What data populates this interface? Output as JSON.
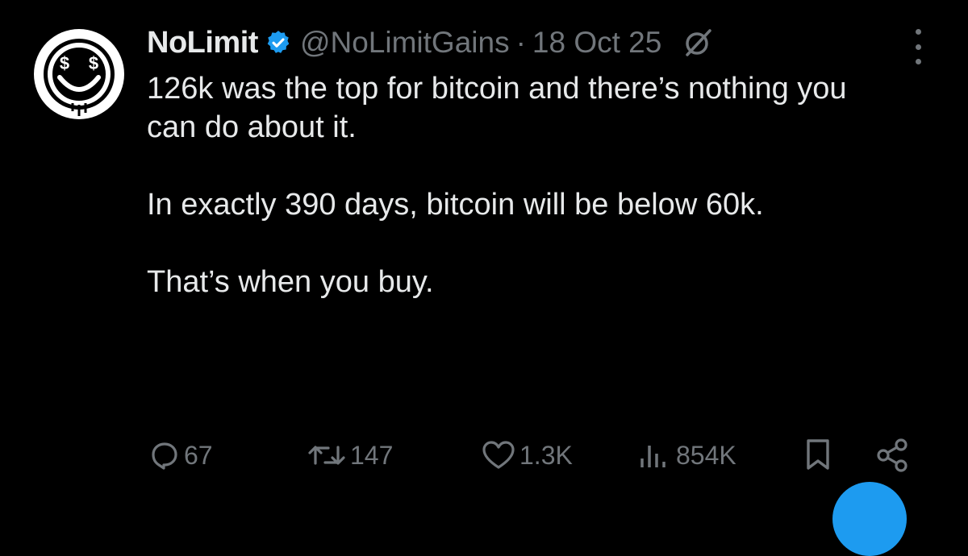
{
  "tweet": {
    "author_name": "NoLimit",
    "handle": "@NoLimitGains",
    "separator": "·",
    "date": "18 Oct 25",
    "paragraphs": [
      "126k was the top for bitcoin and there’s nothing you can do about it.",
      "In exactly 390 days, bitcoin will be below 60k.",
      "That’s when you buy."
    ]
  },
  "avatar_text": "$ $",
  "actions": {
    "replies": "67",
    "reposts": "147",
    "likes": "1.3K",
    "views": "854K"
  },
  "icons": {
    "verified": "verified-badge-icon",
    "grok": "grok-icon",
    "more": "more-icon",
    "reply": "reply-icon",
    "repost": "repost-icon",
    "like": "like-icon",
    "views": "views-icon",
    "bookmark": "bookmark-icon",
    "share": "share-icon"
  },
  "colors": {
    "background": "#000000",
    "text_primary": "#e7e9ea",
    "text_secondary": "#71767b",
    "accent": "#1d9bf0"
  }
}
